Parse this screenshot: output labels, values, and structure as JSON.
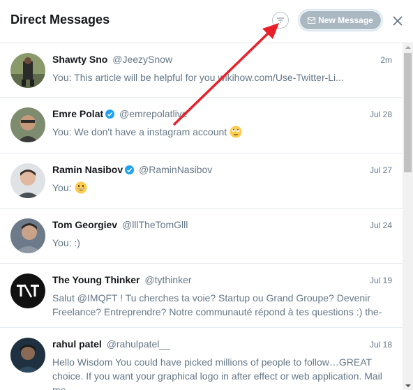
{
  "header": {
    "title": "Direct Messages",
    "new_message_label": "New Message"
  },
  "icons": {
    "filter": "filter-icon",
    "compose": "envelope-icon",
    "close": "close-icon",
    "verified": "verified-badge-icon"
  },
  "colors": {
    "verified_blue": "#1da1f2",
    "disabled_button": "#aab8c2",
    "annotation_arrow": "#e8202a"
  },
  "conversations": [
    {
      "name": "Shawty Sno",
      "handle": "@JeezySnow",
      "time": "2m",
      "verified": false,
      "message": "You: This article will be helpful for you wikihow.com/Use-Twitter-Li..."
    },
    {
      "name": "Emre Polat",
      "handle": "@emrepolatlive",
      "time": "Jul 28",
      "verified": true,
      "message": "You: We don't have a instagram account",
      "emoji": "rolling-eyes-emoji"
    },
    {
      "name": "Ramin Nasibov",
      "handle": "@RaminNasibov",
      "time": "Jul 27",
      "verified": true,
      "message": "You:",
      "emoji": "grinning-emoji"
    },
    {
      "name": "Tom Georgiev",
      "handle": "@lllTheTomGlll",
      "time": "Jul 24",
      "verified": false,
      "message": "You: :)"
    },
    {
      "name": "The Young Thinker",
      "handle": "@tythinker",
      "time": "Jul 19",
      "verified": false,
      "message": "Salut @IMQFT ! Tu cherches ta voie? Startup ou Grand Groupe? Devenir Freelance? Entreprendre? Notre communauté répond à tes questions :) the-"
    },
    {
      "name": "rahul patel",
      "handle": "@rahulpatel__",
      "time": "Jul 18",
      "verified": false,
      "message": "Hello Wisdom You could have picked millions of people to follow…GREAT choice. If you want your graphical logo in after effect or web application. Mail me"
    }
  ]
}
